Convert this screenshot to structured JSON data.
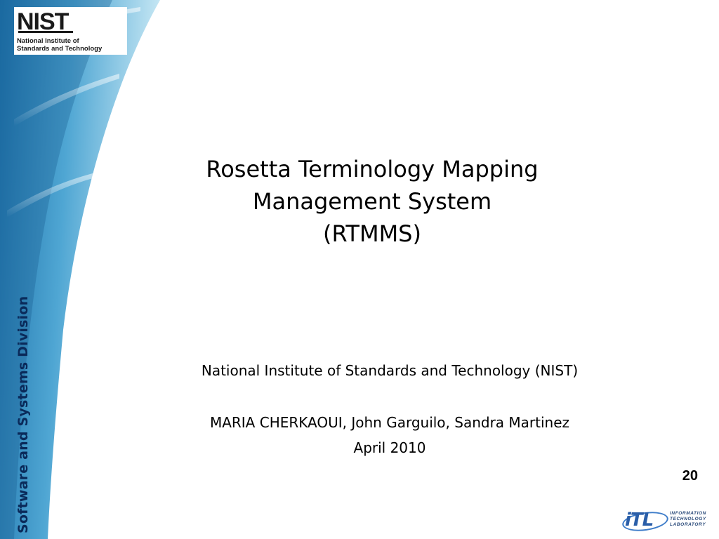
{
  "logo": {
    "mark": "NIST",
    "name": "National Institute of\nStandards and Technology"
  },
  "side_label": "Software and Systems Division",
  "title": {
    "line1": "Rosetta Terminology Mapping",
    "line2": "Management System",
    "line3": "(RTMMS)"
  },
  "organization": "National Institute of Standards and Technology (NIST)",
  "authors": "MARIA CHERKAOUI, John Garguilo, Sandra Martinez",
  "date": "April 2010",
  "page_number": "20",
  "itl_logo": {
    "mark": "iTL",
    "text": "INFORMATION\nTECHNOLOGY\nLABORATORY"
  },
  "colors": {
    "swoosh_dark": "#1b6fa8",
    "swoosh_light": "#bfe3f2",
    "side_label": "#0a2a5a"
  }
}
